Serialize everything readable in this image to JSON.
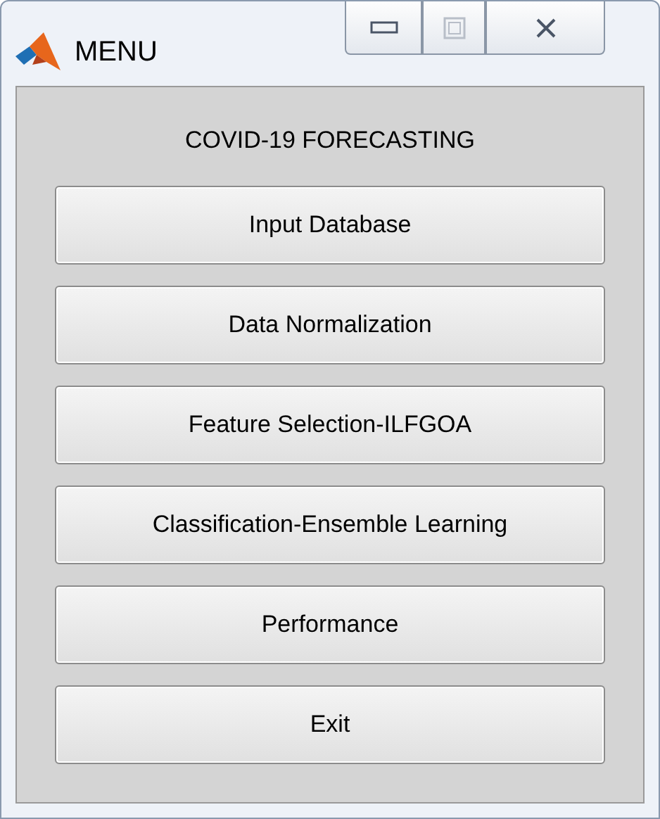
{
  "window": {
    "title": "MENU"
  },
  "window_controls": [
    {
      "kind": "minimize",
      "disabled": false
    },
    {
      "kind": "maximize",
      "disabled": true
    },
    {
      "kind": "close",
      "disabled": false
    }
  ],
  "heading": "COVID-19 FORECASTING",
  "buttons": [
    {
      "label": "Input Database"
    },
    {
      "label": "Data Normalization"
    },
    {
      "label": "Feature Selection-ILFGOA"
    },
    {
      "label": "Classification-Ensemble Learning"
    },
    {
      "label": "Performance"
    },
    {
      "label": "Exit"
    }
  ]
}
